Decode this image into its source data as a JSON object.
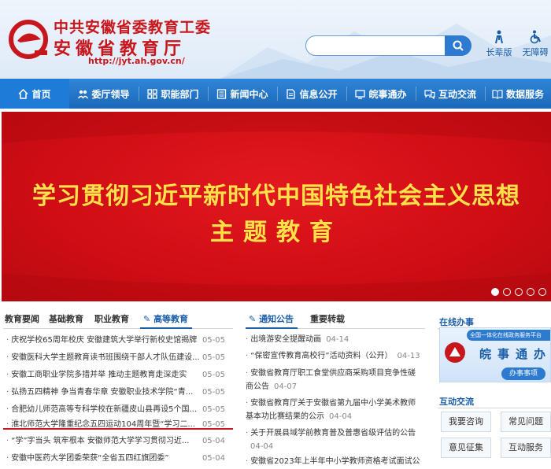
{
  "header": {
    "title_line1": "中共安徽省委教育工委",
    "title_line2": "安徽省教育厅",
    "url": "http://jyt.ah.gov.cn/",
    "search_placeholder": "",
    "elder_label": "长辈版",
    "accessibility_label": "无障碍"
  },
  "nav": {
    "items": [
      {
        "label": "首页",
        "icon": "home-icon"
      },
      {
        "label": "委厅领导",
        "icon": "people-icon"
      },
      {
        "label": "职能部门",
        "icon": "org-icon"
      },
      {
        "label": "新闻中心",
        "icon": "news-icon"
      },
      {
        "label": "信息公开",
        "icon": "doc-icon"
      },
      {
        "label": "皖事通办",
        "icon": "service-icon"
      },
      {
        "label": "互动交流",
        "icon": "chat-icon"
      },
      {
        "label": "数据服务",
        "icon": "book-icon"
      }
    ]
  },
  "banner": {
    "line1": "学习贯彻习近平新时代中国特色社会主义思想",
    "line2": "主题教育"
  },
  "news": {
    "tabs": [
      "教育要闻",
      "基础教育",
      "职业教育",
      "高等教育"
    ],
    "active_tab": "高等教育",
    "items": [
      {
        "title": "庆祝学校65周年校庆 安徽建筑大学举行新校史馆揭牌",
        "date": "05-05"
      },
      {
        "title": "安徽医科大学主题教育读书班围绕干部人才队伍建设...",
        "date": "05-05"
      },
      {
        "title": "安徽工商职业学院多措并举 推动主题教育走深走实",
        "date": "05-05"
      },
      {
        "title": "弘扬五四精神 争当青春华章 安徽职业技术学院“青...",
        "date": "05-05"
      },
      {
        "title": "合肥幼儿师范高等专科学校在新疆皮山县再设5个国...",
        "date": "05-05"
      },
      {
        "title": "淮北师范大学隆重纪念五四运动104周年暨“学习二...",
        "date": "05-05"
      },
      {
        "title": "“学”字当头 筑牢根本 安徽师范大学学习贯彻习近...",
        "date": "05-04"
      },
      {
        "title": "安徽中医药大学团委荣获“全省五四红旗团委”",
        "date": "05-04"
      }
    ]
  },
  "notices": {
    "tabs": [
      "通知公告",
      "重要转载"
    ],
    "active_tab": "通知公告",
    "items": [
      {
        "title": "出境游安全提醒动画",
        "date": "04-14"
      },
      {
        "title": "“保密宣传教育高校行”活动资料（公开）",
        "date": "04-13"
      },
      {
        "title": "安徽省教育厅职工食堂供应商采购项目竞争性磋商公告",
        "date": "04-07"
      },
      {
        "title": "安徽省教育厅关于安徽省第九届中小学美术教师基本功比赛结果的公示",
        "date": "04-04"
      },
      {
        "title": "关于开展县域学前教育普及普惠省级评估的公告",
        "date": "04-04"
      },
      {
        "title": "安徽省2023年上半年中小学教师资格考试面试公告",
        "date": ""
      }
    ]
  },
  "side": {
    "online_title": "在线办事",
    "online_strap": "全国一体化在线政务服务平台",
    "online_big": "皖事通办",
    "online_btn": "办事事项",
    "interact_title": "互动交流",
    "buttons": [
      "我要咨询",
      "常见问题",
      "意见征集",
      "互动服务"
    ]
  },
  "colors": {
    "brand_red": "#c8161d",
    "nav_blue": "#1b67b8",
    "link_blue": "#1a5ea8",
    "banner_yellow": "#ffe24a"
  }
}
